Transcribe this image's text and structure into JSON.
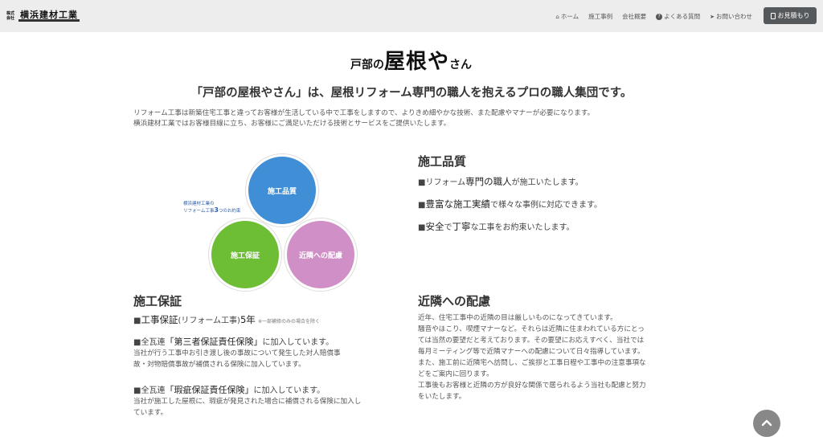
{
  "brand": {
    "small": "株式会社",
    "main": "横浜建材工業"
  },
  "nav": {
    "items": [
      {
        "icon": "home-icon",
        "glyph": "⌂",
        "label": "ホーム"
      },
      {
        "icon": "",
        "glyph": "",
        "label": "施工事例"
      },
      {
        "icon": "",
        "glyph": "",
        "label": "会社概要"
      },
      {
        "icon": "question-icon",
        "glyph": "?",
        "label": "よくある質問"
      },
      {
        "icon": "paper-plane-icon",
        "glyph": "➤",
        "label": "お問い合わせ"
      }
    ],
    "estimate_label": "お見積もり"
  },
  "page_logo": {
    "a": "戸部の",
    "b": "屋根や",
    "c": "さん"
  },
  "headline": "「戸部の屋根やさん」は、屋根リフォーム専門の職人を抱えるプロの職人集団です。",
  "intro": [
    "リフォーム工事は新築住宅工事と違ってお客様が生活している中で工事をしますので、よりきめ細やかな技術、また配慮やマナーが必要になります。",
    "横浜建材工業ではお客様目線に立ち、お客様にご満足いただける技術とサービスをご提供いたします。"
  ],
  "venn": {
    "note_line1": "横浜建材工業の",
    "note_line2a": "リフォーム工事",
    "note_num": "3",
    "note_line2b": "つのお約束",
    "circle1": "施工品質",
    "circle2": "施工保証",
    "circle3": "近隣への配慮",
    "colors": {
      "blue": "#3f8ed6",
      "green": "#6dbd35",
      "pink": "#d08fc6"
    }
  },
  "quality": {
    "title": "施工品質",
    "b1": {
      "pre": "■リフォーム",
      "em": "専門の職人",
      "post": "が施工いたします。"
    },
    "b2": {
      "pre": "■",
      "em": "豊富な施工実績",
      "post": "で様々な事例に対応できます。"
    },
    "b3": {
      "pre": "■",
      "em1": "安全",
      "mid": "で",
      "em2": "丁寧",
      "post": "な工事をお約束いたします。"
    }
  },
  "warranty": {
    "title": "施工保証",
    "l1": {
      "pre": "■",
      "em": "工事保証",
      "mid": "(リフォーム工事)",
      "em2": "5年",
      "note": "※一部補修のみの場合を除く"
    },
    "l2": {
      "pre": "■全瓦連",
      "em": "「第三者保証責任保険」",
      "post": "に加入しています。"
    },
    "l2_body": [
      "当社が行う工事中お引き渡し後の事故について発生した対人賠償事",
      "故・対物賠償事故が補償される保険に加入しています。"
    ],
    "l3": {
      "pre": "■全瓦連",
      "em": "「瑕疵保証責任保険」",
      "post": "に加入しています。"
    },
    "l3_body": [
      "当社が施工した屋根に、瑕疵が発見された場合に補償される保険に加入し",
      "ています。"
    ]
  },
  "neighbors": {
    "title": "近隣への配慮",
    "body": [
      "近年、住宅工事中の近隣の目は厳しいものになってきています。",
      "騒音やほこり、喫煙マナーなど。それらは近隣に住まわれている方にとっ",
      "ては当然の要望だと考えております。その要望にお応えすべく、当社では",
      "毎月ミーティング等で近隣マナーへの配慮について日々指導しています。",
      "また、施工前に近隣宅へ訪問し、ご挨拶と工事日程や工事中の注意事項な",
      "どをご案内に回ります。",
      "工事後もお客様と近隣の方が良好な関係で居られるよう当社も配慮と努力",
      "をいたします。"
    ]
  }
}
